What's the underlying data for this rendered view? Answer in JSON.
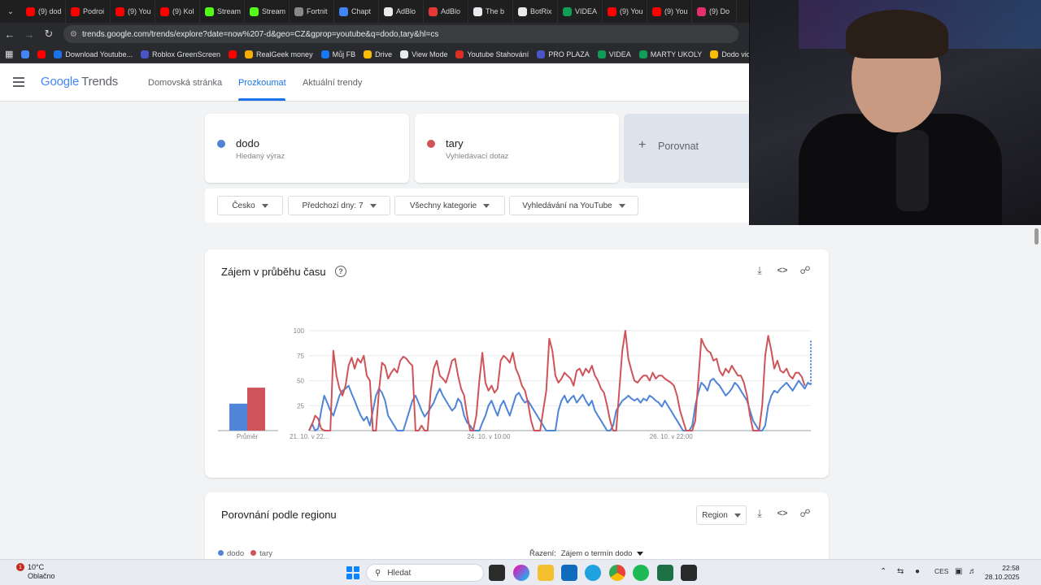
{
  "browser": {
    "tabs": [
      {
        "label": "(9) dod",
        "color": "#ff0000"
      },
      {
        "label": "Podroi",
        "color": "#ff0000"
      },
      {
        "label": "(9) You",
        "color": "#ff0000"
      },
      {
        "label": "(9) Kol",
        "color": "#ff0000"
      },
      {
        "label": "Stream",
        "color": "#53fc18"
      },
      {
        "label": "Stream",
        "color": "#53fc18"
      },
      {
        "label": "Fortnit",
        "color": "#888888"
      },
      {
        "label": "Chapt",
        "color": "#4285f4"
      },
      {
        "label": "AdBlo",
        "color": "#e8eaed"
      },
      {
        "label": "AdBlo",
        "color": "#e53935"
      },
      {
        "label": "The b",
        "color": "#e8eaed"
      },
      {
        "label": "BotRix",
        "color": "#e8eaed"
      },
      {
        "label": "VIDEA",
        "color": "#0f9d58"
      },
      {
        "label": "(9) You",
        "color": "#ff0000"
      },
      {
        "label": "(9) You",
        "color": "#ff0000"
      },
      {
        "label": "(9) Do",
        "color": "#e1306c"
      }
    ],
    "url": "trends.google.com/trends/explore?date=now%207-d&geo=CZ&gprop=youtube&q=dodo,tary&hl=cs",
    "bookmarks": [
      {
        "label": "",
        "color": "#4285f4"
      },
      {
        "label": "",
        "color": "#ff0000"
      },
      {
        "label": "Download Youtube...",
        "color": "#1a73e8"
      },
      {
        "label": "Roblox GreenScreen",
        "color": "#4a55c8"
      },
      {
        "label": "",
        "color": "#ff0000"
      },
      {
        "label": "RealGeek money",
        "color": "#f9ab00"
      },
      {
        "label": "Můj FB",
        "color": "#1877f2"
      },
      {
        "label": "Drive",
        "color": "#fbbc04"
      },
      {
        "label": "View Mode",
        "color": "#e8eaed"
      },
      {
        "label": "Youtube Stahování",
        "color": "#d93025"
      },
      {
        "label": "PRO PLAZA",
        "color": "#4a55c8"
      },
      {
        "label": "VIDEA",
        "color": "#0f9d58"
      },
      {
        "label": "MARTY UKOLY",
        "color": "#0f9d58"
      },
      {
        "label": "Dodo vide",
        "color": "#fbbc04"
      }
    ]
  },
  "header": {
    "logo_google": "Google",
    "logo_trends": "Trends",
    "nav": [
      "Domovská stránka",
      "Prozkoumat",
      "Aktuální trendy"
    ]
  },
  "terms": [
    {
      "name": "dodo",
      "sub": "Hledaný výraz",
      "color": "#4f84d6"
    },
    {
      "name": "tary",
      "sub": "Vyhledávací dotaz",
      "color": "#cf5459"
    }
  ],
  "compare_label": "Porovnat",
  "filters": [
    "Česko",
    "Předchozí dny: 7",
    "Všechny kategorie",
    "Vyhledávání na YouTube"
  ],
  "interest_card": {
    "title": "Zájem v průběhu času"
  },
  "region_card": {
    "title": "Porovnání podle regionu",
    "select": "Region",
    "legend": [
      "dodo",
      "tary"
    ],
    "sort_label": "Řazení:",
    "sort_value": "Zájem o termín dodo"
  },
  "chart_data": {
    "type": "line",
    "yticks": [
      0,
      25,
      50,
      75,
      100
    ],
    "xtick_labels": [
      "21. 10. v 22...",
      "24. 10. v 10:00",
      "26. 10. v 22:00"
    ],
    "xtick_index": [
      0,
      60,
      120
    ],
    "average_label": "Průměr",
    "average_values": {
      "dodo": 27,
      "tary": 43
    },
    "ylim": [
      0,
      100
    ],
    "series": [
      {
        "name": "dodo",
        "color": "#4f84d6",
        "values": [
          0,
          7,
          0,
          2,
          20,
          35,
          28,
          20,
          15,
          25,
          35,
          40,
          42,
          45,
          37,
          30,
          22,
          15,
          10,
          14,
          5,
          20,
          35,
          42,
          38,
          30,
          15,
          10,
          5,
          0,
          0,
          0,
          10,
          20,
          30,
          35,
          28,
          20,
          14,
          18,
          23,
          28,
          36,
          42,
          35,
          30,
          25,
          20,
          23,
          32,
          28,
          15,
          8,
          5,
          0,
          0,
          0,
          8,
          15,
          25,
          30,
          22,
          15,
          25,
          30,
          22,
          15,
          25,
          35,
          38,
          32,
          28,
          30,
          25,
          20,
          15,
          10,
          5,
          0,
          0,
          0,
          0,
          20,
          30,
          35,
          28,
          32,
          35,
          28,
          32,
          36,
          30,
          25,
          30,
          20,
          15,
          10,
          5,
          0,
          0,
          5,
          20,
          25,
          30,
          32,
          35,
          32,
          30,
          32,
          28,
          32,
          30,
          35,
          33,
          30,
          28,
          24,
          30,
          25,
          20,
          15,
          10,
          5,
          0,
          0,
          0,
          5,
          25,
          38,
          48,
          45,
          40,
          50,
          52,
          48,
          45,
          40,
          35,
          38,
          42,
          48,
          45,
          40,
          35,
          30,
          20,
          10,
          5,
          0,
          0,
          5,
          25,
          35,
          40,
          38,
          42,
          45,
          48,
          44,
          40,
          45,
          50,
          46,
          42,
          48,
          46
        ]
      },
      {
        "name": "tary",
        "color": "#cf5459",
        "values": [
          0,
          6,
          15,
          12,
          2,
          0,
          0,
          0,
          80,
          55,
          42,
          35,
          45,
          65,
          73,
          62,
          72,
          68,
          75,
          55,
          50,
          0,
          0,
          40,
          68,
          65,
          52,
          58,
          62,
          58,
          70,
          74,
          72,
          68,
          65,
          0,
          0,
          5,
          0,
          0,
          40,
          62,
          70,
          55,
          52,
          48,
          58,
          70,
          72,
          55,
          42,
          35,
          15,
          0,
          0,
          15,
          50,
          78,
          48,
          40,
          45,
          38,
          42,
          70,
          75,
          72,
          68,
          78,
          62,
          55,
          45,
          40,
          28,
          10,
          0,
          0,
          0,
          20,
          40,
          92,
          80,
          55,
          48,
          52,
          58,
          55,
          52,
          45,
          60,
          62,
          55,
          62,
          58,
          65,
          55,
          50,
          42,
          38,
          25,
          10,
          0,
          0,
          40,
          80,
          100,
          72,
          60,
          50,
          48,
          52,
          55,
          55,
          50,
          58,
          52,
          55,
          55,
          52,
          50,
          48,
          45,
          35,
          20,
          10,
          0,
          0,
          0,
          10,
          50,
          92,
          85,
          80,
          78,
          70,
          72,
          60,
          55,
          62,
          58,
          65,
          60,
          55,
          55,
          48,
          35,
          15,
          0,
          0,
          0,
          25,
          75,
          95,
          80,
          62,
          70,
          60,
          58,
          62,
          55,
          52,
          58,
          58,
          54,
          45
        ]
      }
    ]
  },
  "taskbar": {
    "weather_badge": "1",
    "temp": "10°C",
    "weather": "Oblačno",
    "search": "Hledat",
    "lang": "CES",
    "time": "22:58",
    "date": "28.10.2025"
  }
}
